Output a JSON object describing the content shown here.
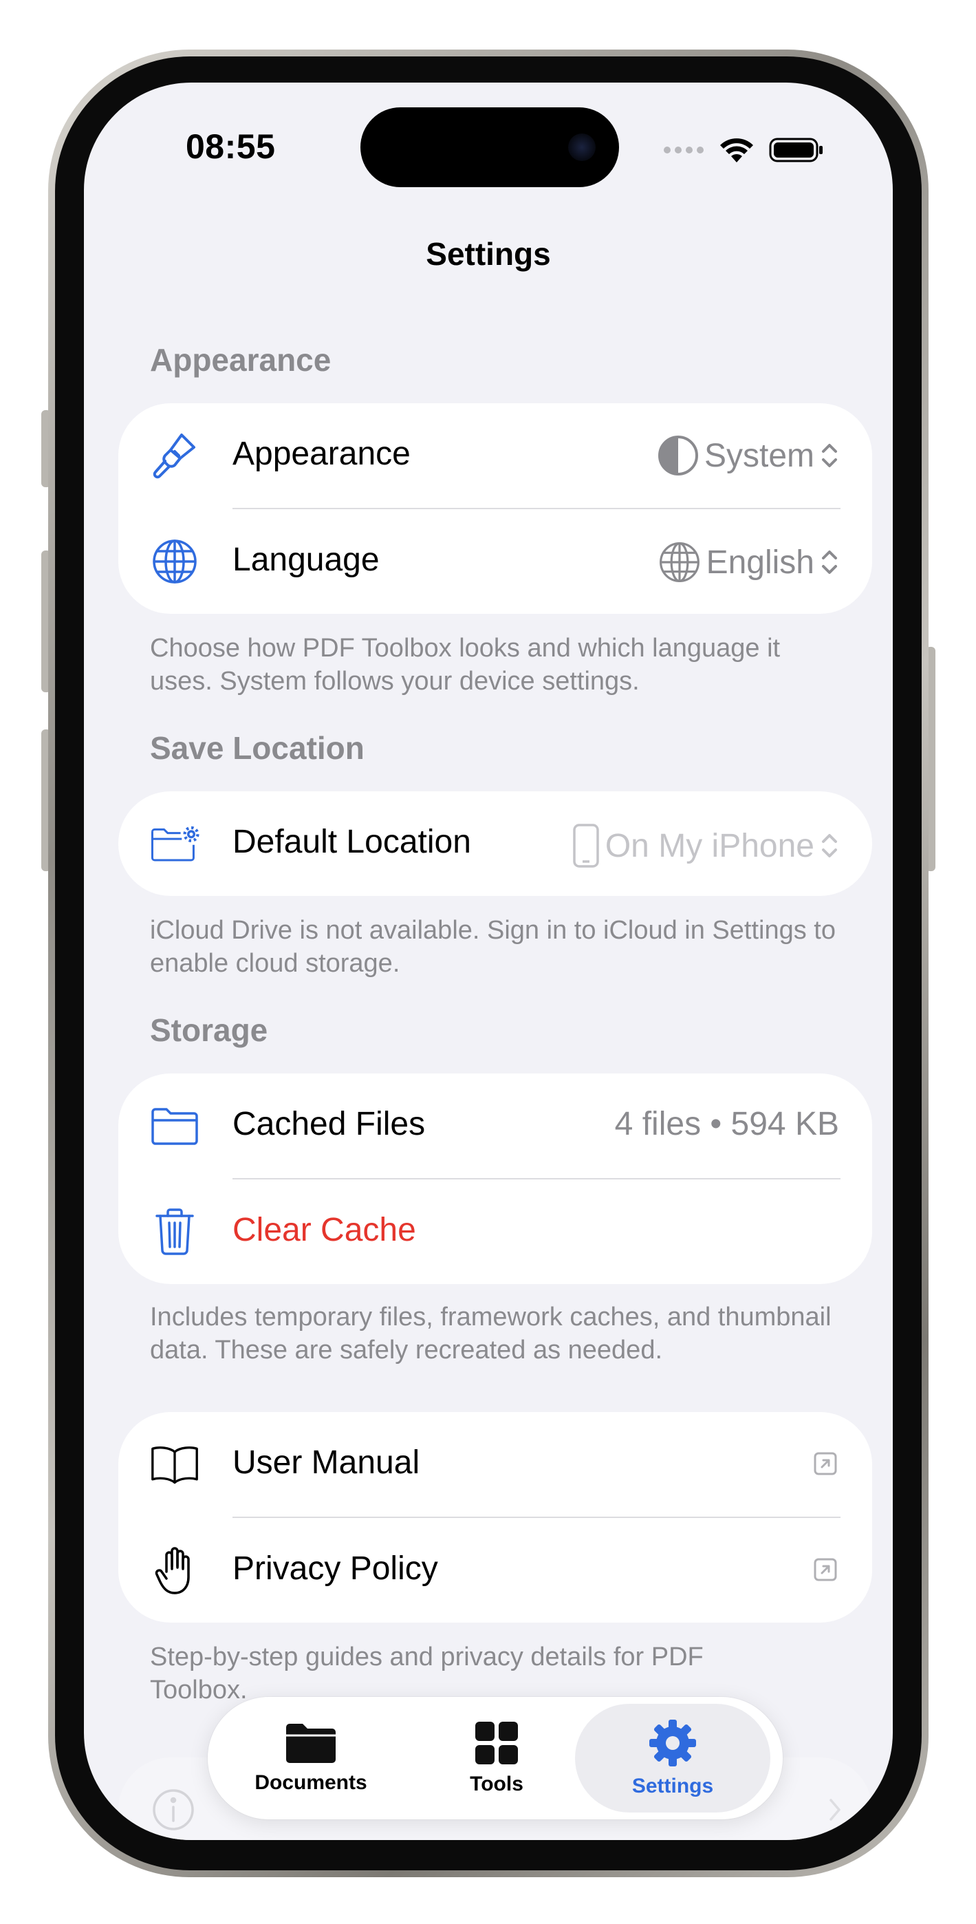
{
  "status_bar": {
    "time": "08:55"
  },
  "nav": {
    "title": "Settings"
  },
  "appearance_section": {
    "header": "Appearance",
    "rows": [
      {
        "label": "Appearance",
        "value": "System"
      },
      {
        "label": "Language",
        "value": "English"
      }
    ],
    "footer": "Choose how PDF Toolbox looks and which language it uses. System follows your device settings."
  },
  "save_location_section": {
    "header": "Save Location",
    "row": {
      "label": "Default Location",
      "value": "On My iPhone"
    },
    "footer": "iCloud Drive is not available. Sign in to iCloud in Settings to enable cloud storage."
  },
  "storage_section": {
    "header": "Storage",
    "cached_files": {
      "label": "Cached Files",
      "value": "4 files • 594 KB"
    },
    "clear_cache": {
      "label": "Clear Cache"
    },
    "footer": "Includes temporary files, framework caches, and thumbnail data. These are safely recreated as needed."
  },
  "info_section": {
    "rows": [
      {
        "label": "User Manual"
      },
      {
        "label": "Privacy Policy"
      }
    ],
    "footer": "Step-by-step guides and privacy details for PDF Toolbox."
  },
  "tab_bar": {
    "tabs": [
      {
        "label": "Documents",
        "icon": "folder-icon"
      },
      {
        "label": "Tools",
        "icon": "grid-icon"
      },
      {
        "label": "Settings",
        "icon": "gear-icon",
        "active": true
      }
    ]
  },
  "colors": {
    "accent": "#2f6bde",
    "destructive": "#e5352c",
    "secondary_text": "#8a8a8e",
    "background": "#f2f2f7"
  }
}
